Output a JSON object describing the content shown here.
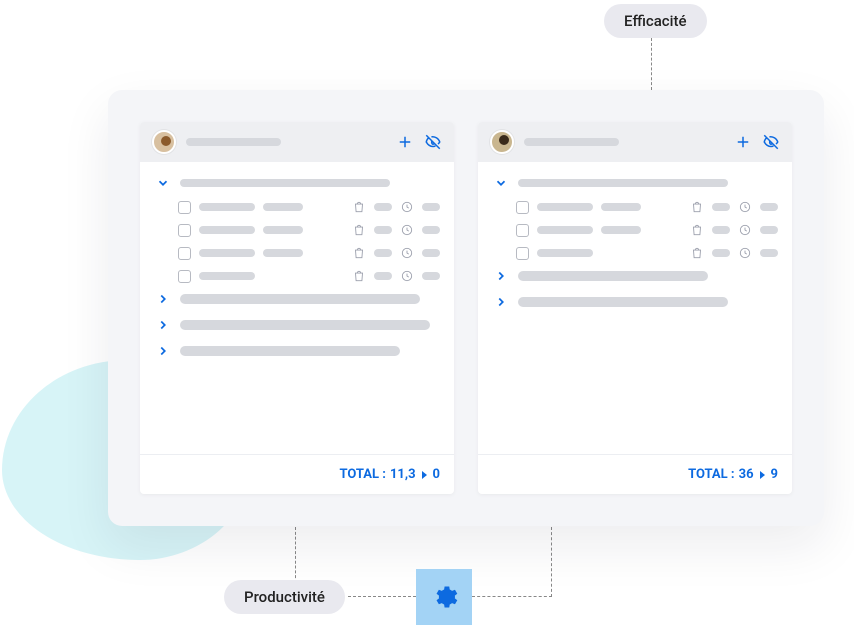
{
  "tags": {
    "efficacite": "Efficacité",
    "productivite": "Productivité"
  },
  "cards": {
    "left": {
      "total_label": "TOTAL :",
      "total_primary": "11,3",
      "total_secondary": "0"
    },
    "right": {
      "total_label": "TOTAL :",
      "total_primary": "36",
      "total_secondary": "9"
    }
  },
  "icons": {
    "plus": "plus-icon",
    "eye_off": "eye-off-icon",
    "gear": "gear-icon",
    "chevron_down": "chevron-down-icon",
    "chevron_right": "chevron-right-icon",
    "bag": "bag-icon",
    "clock": "clock-icon"
  },
  "colors": {
    "accent": "#0d6ae0",
    "gear_bg": "#a3d3f5",
    "blob": "#d7f4f7",
    "tag_bg": "#e9e9ef"
  }
}
